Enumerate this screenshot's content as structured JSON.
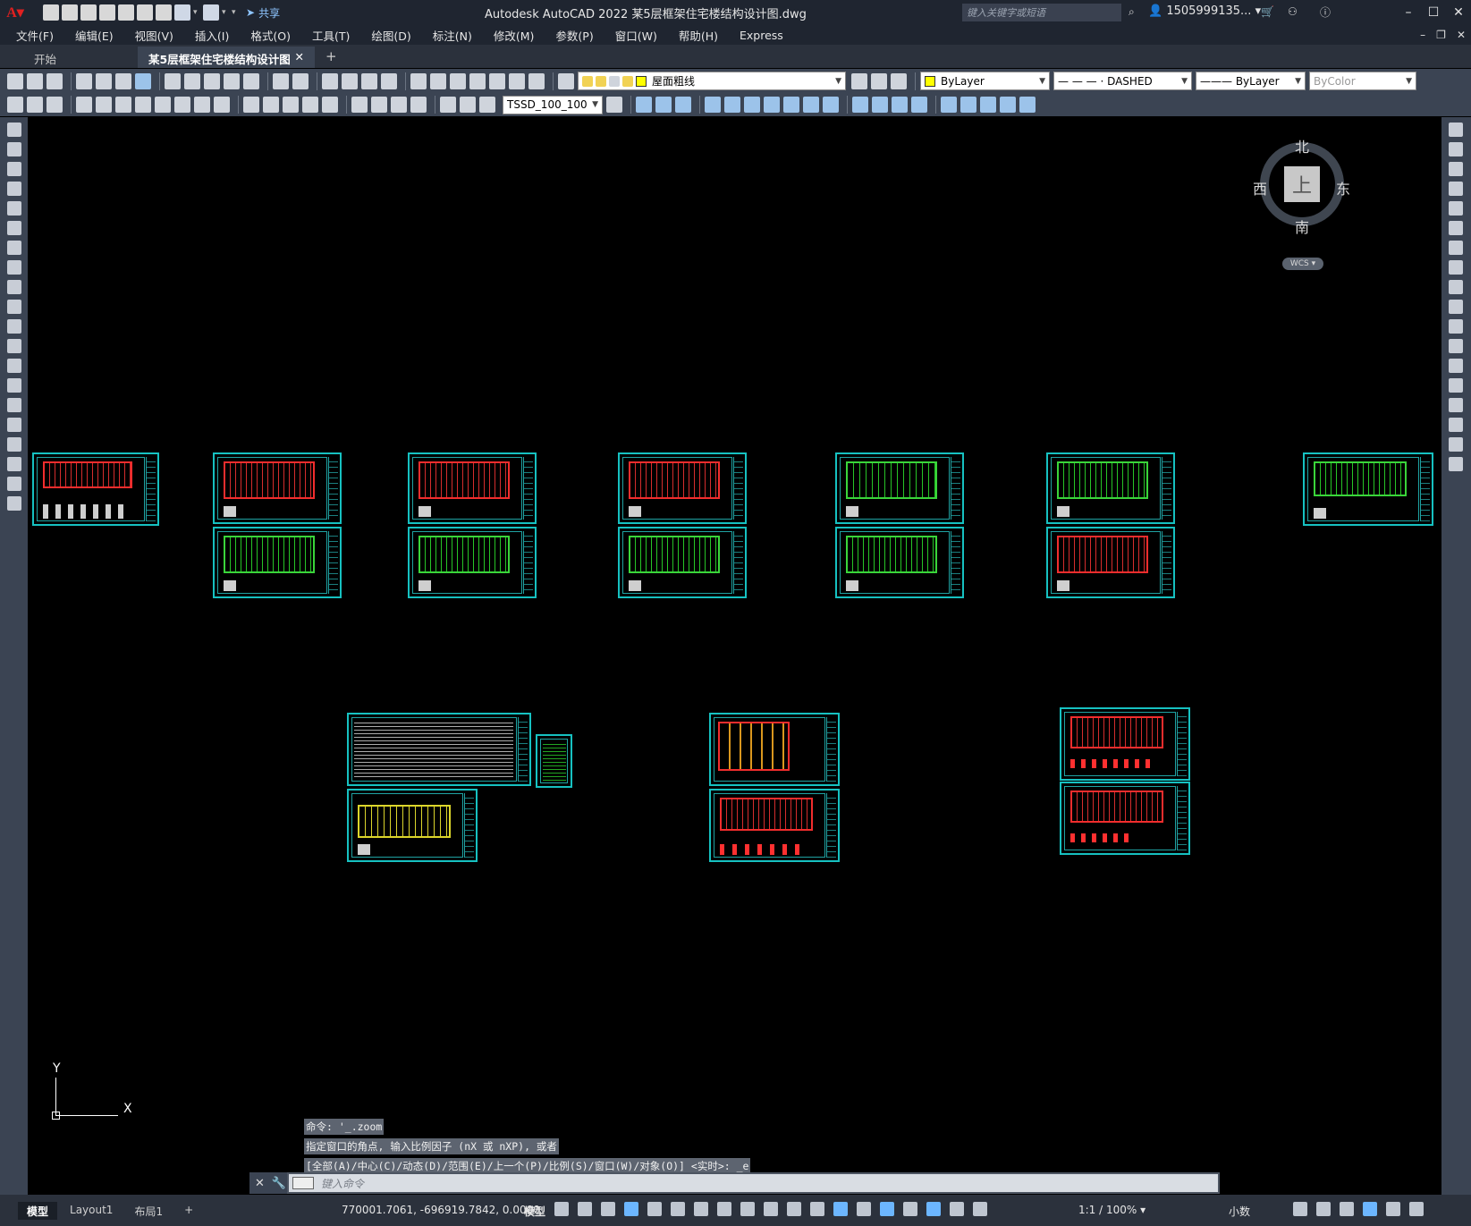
{
  "app": {
    "title": "Autodesk AutoCAD 2022    某5层框架住宅楼结构设计图.dwg",
    "share_label": "共享",
    "search_placeholder": "键入关键字或短语",
    "user": "1505999135... ▾"
  },
  "menu": [
    "文件(F)",
    "编辑(E)",
    "视图(V)",
    "插入(I)",
    "格式(O)",
    "工具(T)",
    "绘图(D)",
    "标注(N)",
    "修改(M)",
    "参数(P)",
    "窗口(W)",
    "帮助(H)",
    "Express"
  ],
  "tabs": {
    "start": "开始",
    "active": "某5层框架住宅楼结构设计图*",
    "close": "✕",
    "add": "+"
  },
  "toolbar": {
    "layer": "屋面粗线",
    "color": "ByLayer",
    "linetype": "— — — · DASHED",
    "lineweight": "——— ByLayer",
    "plotstyle": "ByColor",
    "dimstyle": "TSSD_100_100"
  },
  "viewcube": {
    "north": "北",
    "south": "南",
    "east": "东",
    "west": "西",
    "face": "上",
    "wcs": "WCS ▾"
  },
  "ucs": {
    "x": "X",
    "y": "Y"
  },
  "command": {
    "history": [
      "命令: '_.zoom",
      "指定窗口的角点, 输入比例因子 (nX 或 nXP), 或者",
      "[全部(A)/中心(C)/动态(D)/范围(E)/上一个(P)/比例(S)/窗口(W)/对象(O)] <实时>: _e"
    ],
    "placeholder": "键入命令"
  },
  "status": {
    "layout_tabs": [
      "模型",
      "Layout1",
      "布局1"
    ],
    "add_layout": "+",
    "coords": "770001.7061, -696919.7842, 0.0000",
    "model": "模型",
    "scale": "1:1 / 100% ▾",
    "units": "小数"
  },
  "colors": {
    "sheet_border": "#16c1c1",
    "plan_green": "#3ee13e",
    "plan_red": "#ff3030",
    "ui_dark": "#1f2530",
    "toolbar": "#3b4453"
  }
}
